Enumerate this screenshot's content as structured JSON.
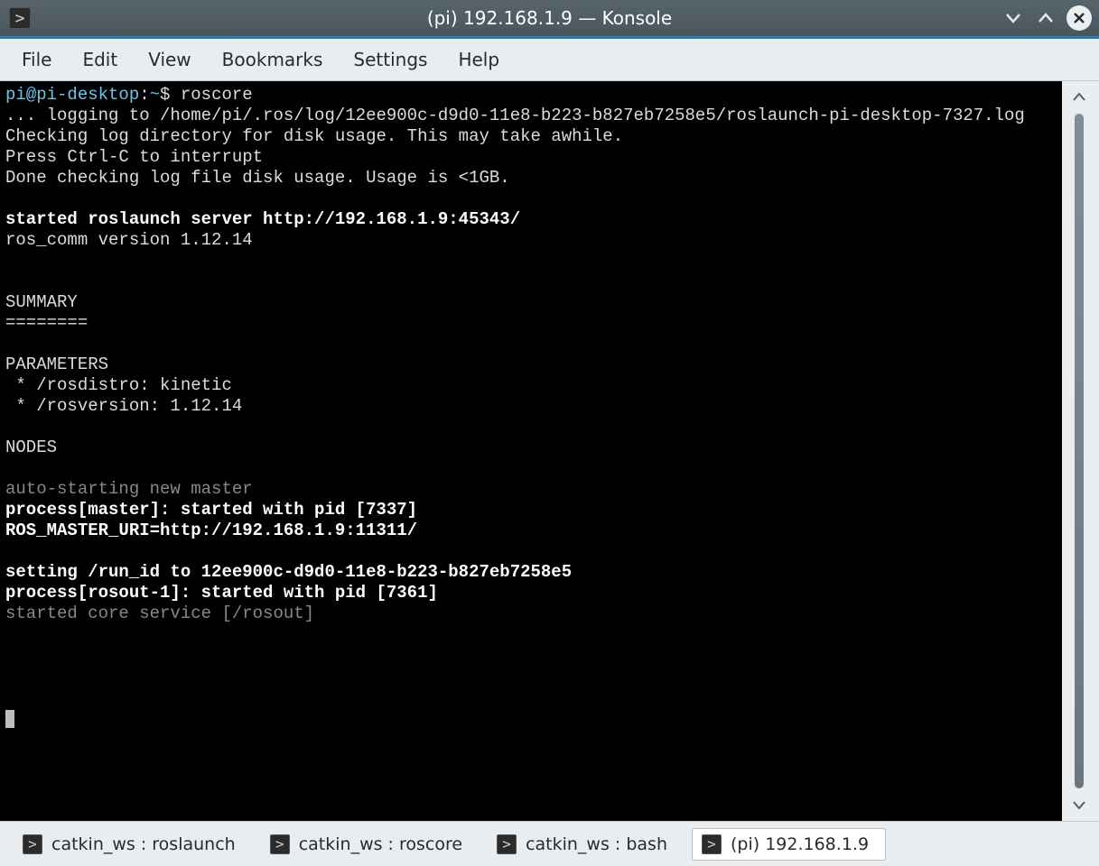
{
  "window": {
    "title": "(pi) 192.168.1.9 — Konsole"
  },
  "menubar": {
    "items": [
      "File",
      "Edit",
      "View",
      "Bookmarks",
      "Settings",
      "Help"
    ]
  },
  "terminal": {
    "prompt_user_host": "pi@pi-desktop",
    "prompt_sep": ":",
    "prompt_path": "~",
    "prompt_dollar": "$",
    "command": "roscore",
    "line_logging": "... logging to /home/pi/.ros/log/12ee900c-d9d0-11e8-b223-b827eb7258e5/roslaunch-pi-desktop-7327.log",
    "line_checking": "Checking log directory for disk usage. This may take awhile.",
    "line_press": "Press Ctrl-C to interrupt",
    "line_done": "Done checking log file disk usage. Usage is <1GB.",
    "line_started_server": "started roslaunch server http://192.168.1.9:45343/",
    "line_roscomm": "ros_comm version 1.12.14",
    "line_summary": "SUMMARY",
    "line_summary_rule": "========",
    "line_parameters": "PARAMETERS",
    "line_rosdistro": " * /rosdistro: kinetic",
    "line_rosversion": " * /rosversion: 1.12.14",
    "line_nodes": "NODES",
    "line_autostart": "auto-starting new master",
    "line_process_master": "process[master]: started with pid [7337]",
    "line_master_uri": "ROS_MASTER_URI=http://192.168.1.9:11311/",
    "line_runid": "setting /run_id to 12ee900c-d9d0-11e8-b223-b827eb7258e5",
    "line_process_rosout": "process[rosout-1]: started with pid [7361]",
    "line_started_core": "started core service [/rosout]"
  },
  "tabs": {
    "items": [
      {
        "label": "catkin_ws : roslaunch",
        "active": false
      },
      {
        "label": "catkin_ws : roscore",
        "active": false
      },
      {
        "label": "catkin_ws : bash",
        "active": false
      },
      {
        "label": "(pi) 192.168.1.9",
        "active": true
      }
    ]
  }
}
